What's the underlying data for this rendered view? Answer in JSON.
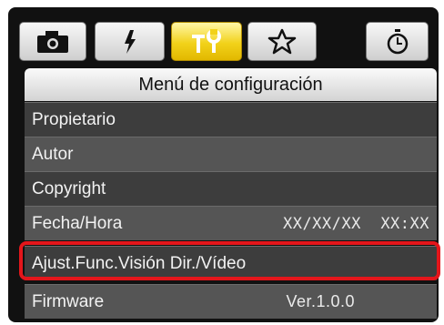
{
  "tabs": [
    {
      "icon": "camera-icon",
      "selected": false
    },
    {
      "icon": "flash-icon",
      "selected": false
    },
    {
      "icon": "tools-icon",
      "selected": true
    },
    {
      "icon": "star-icon",
      "selected": false
    },
    {
      "icon": "timer-icon",
      "selected": false
    }
  ],
  "header": {
    "title": "Menú de configuración"
  },
  "menu": {
    "items": [
      {
        "label": "Propietario",
        "value": ""
      },
      {
        "label": "Autor",
        "value": ""
      },
      {
        "label": "Copyright",
        "value": ""
      },
      {
        "label": "Fecha/Hora",
        "value": "XX/XX/XX  XX:XX"
      },
      {
        "label": "Ajust.Func.Visión Dir./Vídeo",
        "value": "",
        "highlighted": true
      },
      {
        "label": "Firmware",
        "value": "Ver.1.0.0"
      }
    ]
  },
  "colors": {
    "selected_tab": "#f2d21a",
    "highlight": "#e4161b",
    "row_dark": "#3d3d3d",
    "row_light": "#555555"
  }
}
